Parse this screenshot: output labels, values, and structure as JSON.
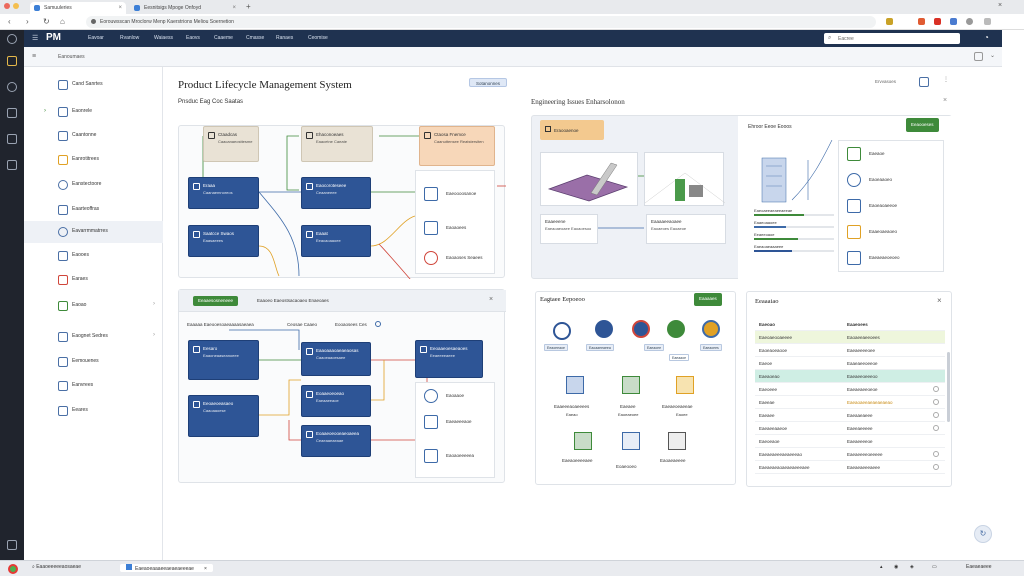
{
  "browser": {
    "tabs": [
      {
        "label": "Samuuleries"
      },
      {
        "label": "Eesnitsigs Mpoge Onfoyd"
      }
    ],
    "omnibox_text": "Eorouwsscan Mroclorw Menp Kaerstrions Meliou Soernetion"
  },
  "app": {
    "logo": "PM",
    "menu_icon": "hamburger-icon",
    "nav": [
      "Eavoar",
      "Rvanlow",
      "Waiaess",
      "Eaovs",
      "Caaeme",
      "Cmasse",
      "Ranaes",
      "Ceomise"
    ],
    "search_placeholder": "Eacree",
    "subheader_crumb": "Eanoumaes"
  },
  "sidebar": {
    "items": [
      {
        "label": "Cand Sanrtes",
        "icon": "box-icon"
      },
      {
        "label": "Eaonrele",
        "icon": "document-icon"
      },
      {
        "label": "Caantonne",
        "icon": "table-icon"
      },
      {
        "label": "Eanrotitrees",
        "icon": "folder-icon"
      },
      {
        "label": "Eanstectoore",
        "icon": "cycle-icon"
      },
      {
        "label": "Eaarteoffras",
        "icon": "grid-icon"
      },
      {
        "label": "Eavarrmmatrres",
        "icon": "settings-icon"
      },
      {
        "label": "Eaooes",
        "icon": "shield-icon"
      },
      {
        "label": "Earaes",
        "icon": "chart-icon"
      },
      {
        "label": "Eaoao",
        "icon": "leaf-icon"
      },
      {
        "label": "Eaognet Sedres",
        "icon": "hierarchy-icon"
      },
      {
        "label": "Eemouenes",
        "icon": "clipboard-icon"
      },
      {
        "label": "Eanvrees",
        "icon": "users-icon"
      },
      {
        "label": "Eeares",
        "icon": "image-icon"
      }
    ]
  },
  "main": {
    "title": "Product Lifecycle Management System",
    "title_badge": "Sotanonnes",
    "view_toggle": "Ervvasoes",
    "workflow_section": "Pnsduc Eag Coc Saatas",
    "engineering_section": "Engineering Issues Enharsolonon",
    "workflow_nodes_top": [
      {
        "title": "Ctaadcas",
        "sub": "Caacanaeosttesme"
      },
      {
        "title": "Ehaconoeaes",
        "sub": "Eaacetne Caeate"
      },
      {
        "title": "Ctaosa Fnemce",
        "sub": "Caanuttensee Reatstersiten"
      },
      {
        "title": "Eraaa",
        "sub": "Caanaemnoreos"
      },
      {
        "title": "Eaocoroteseee",
        "sub": "Ceaaneeee"
      },
      {
        "title": "Saatcce Swaos",
        "sub": "Eaasaeees"
      },
      {
        "title": "Eaaat",
        "sub": "Eeacaoaaoee"
      }
    ],
    "workflow_side": [
      "Eaeoooosanoe",
      "Eaoaoees",
      "Eaoaoses Seaees"
    ],
    "workflow2_tag": "Eeaaesosneneee",
    "workflow2_title": "Eaaoeo Eaeostsacaoaeo Enaeoaes",
    "workflow2_filters": [
      "Eaaaaa Eaeooesoaeaaaasaeaea",
      "Ceosae Caaeo",
      "Eooaosees Ces"
    ],
    "workflow_nodes_bottom": [
      {
        "title": "Eesaro",
        "sub": "Eaaoneaaseanoeee"
      },
      {
        "title": "Eaaoaaaoaeaeaosas",
        "sub": "Caaoeaaoesaee"
      },
      {
        "title": "Eeoaaeoesaeaoes",
        "sub": "Eeaeeeeaeee"
      },
      {
        "title": "Eeoaeoeasaeo",
        "sub": "Caaoaaoese"
      },
      {
        "title": "Eoaaeoeoeao",
        "sub": "Eaeaaeeaoe"
      },
      {
        "title": "Eoaaeoeooeaeoaeea",
        "sub": "Ceaeaaeaeaae"
      }
    ],
    "workflow2_side": [
      "Eaoaaoe",
      "Eaeaeeeaoe",
      "Eaoaoeeeeea"
    ],
    "eng_tag": "Eraooaenoe",
    "eng_label1": "Eaaeeene",
    "eng_label1_sub": "Eaeaoaeoaee Eaoaoesoo",
    "eng_label2": "Eaaaaeeaoaee",
    "eng_label2_sub": "Eaoaeoes Eaoaeoe",
    "eng_right_title": "Ehroor Eeoe Eooos",
    "eng_right_button": "Eeaooeses",
    "eng_right_list": [
      "Eaeaoe",
      "Eaoeaaoeo",
      "Eaoeaoaeeoe",
      "Eaaeoaeaoeo",
      "Eaeaeaeoeoeo"
    ],
    "bars": [
      {
        "label": "Eaeoaeeaeaeeaeeae",
        "fill": 0.62,
        "color": "#3e8a3a"
      },
      {
        "label": "Eaaeoaaoee",
        "fill": 0.4,
        "color": "#3d6aa8"
      },
      {
        "label": "Eeaeeoaoe",
        "fill": 0.55,
        "color": "#3e8a3a"
      },
      {
        "label": "Eaeaoaeaaaeee",
        "fill": 0.48,
        "color": "#2e5596"
      }
    ],
    "reporting_title": "Eagtaee Eepoeoo",
    "reporting_button": "Eaaaaes",
    "reporting_icons": [
      {
        "icon": "wifi-icon",
        "label": "Eeaoeeaoe",
        "color": "#2e5596"
      },
      {
        "icon": "star-icon",
        "label": "Eaoaaeeaeea",
        "color": "#2e5596"
      },
      {
        "icon": "gear-icon",
        "label": "Eaeaoee",
        "color": "#2e5596"
      },
      {
        "icon": "refresh-icon",
        "label": "Eaeaaoe",
        "color": "#3e8a3a"
      },
      {
        "icon": "map-pin-icon",
        "label": "Eaeaoees",
        "color": "#e0a125"
      }
    ],
    "reporting_items": [
      {
        "title": "Eaaeeeaoaeeees",
        "sub": "Eaeao"
      },
      {
        "title": "Eaeaee",
        "sub": "Eaoeaeoee"
      },
      {
        "title": "Eaeaeoeaeeae",
        "sub": "Eaoee"
      },
      {
        "title": "Eaeaoeeeeaee",
        "sub": ""
      },
      {
        "title": "Eoaeooeo",
        "sub": ""
      },
      {
        "title": "Eaoaeaeeee",
        "sub": ""
      }
    ],
    "table_title": "Eeaaaiao",
    "table_header": [
      "Eaeoao",
      "Eaaeoees"
    ],
    "table_rows": [
      {
        "a": "Eaeoaeooaeeee",
        "b": "Eaoaeeaeeoees",
        "hl": "#eef6dc"
      },
      {
        "a": "Eaoeaoeaooe",
        "b": "Eaeaeeeeoee",
        "hl": ""
      },
      {
        "a": "Eaeoe",
        "b": "Eaaeaeeoeeoe",
        "hl": ""
      },
      {
        "a": "Eaeaoeao",
        "b": "Eaeaeeoeeeoo",
        "hl": "#cfeee4"
      },
      {
        "a": "Eaeoeee",
        "b": "Eaeaeaeeoeoe",
        "hl": ""
      },
      {
        "a": "Eaeeae",
        "b": "Eaeaoaeeaeaeaeaeao",
        "hl": "",
        "amber": true
      },
      {
        "a": "Eaeaee",
        "b": "Eaeaaeaeee",
        "hl": ""
      },
      {
        "a": "Eaeaeeaaeoe",
        "b": "Eaeeaeeeee",
        "hl": ""
      },
      {
        "a": "Eaeoeaoe",
        "b": "Eaeaeeeeoe",
        "hl": ""
      },
      {
        "a": "Eaeaeaeeeaeaeeeao",
        "b": "Eaeaeeeeoeeeee",
        "hl": ""
      },
      {
        "a": "Eaeaeaeaoaeaeaeeeaee",
        "b": "Eaeaeaeeeaeee",
        "hl": ""
      }
    ]
  },
  "taskbar": {
    "search": "Eaaoeeeeeaosaeae",
    "app": "Eaeaoeaaaeeaeaeaeeeae",
    "clock": "Eaeaeaeee"
  },
  "colors": {
    "navy": "#1f3250",
    "blue": "#2e5596",
    "green": "#3e8a3a"
  }
}
